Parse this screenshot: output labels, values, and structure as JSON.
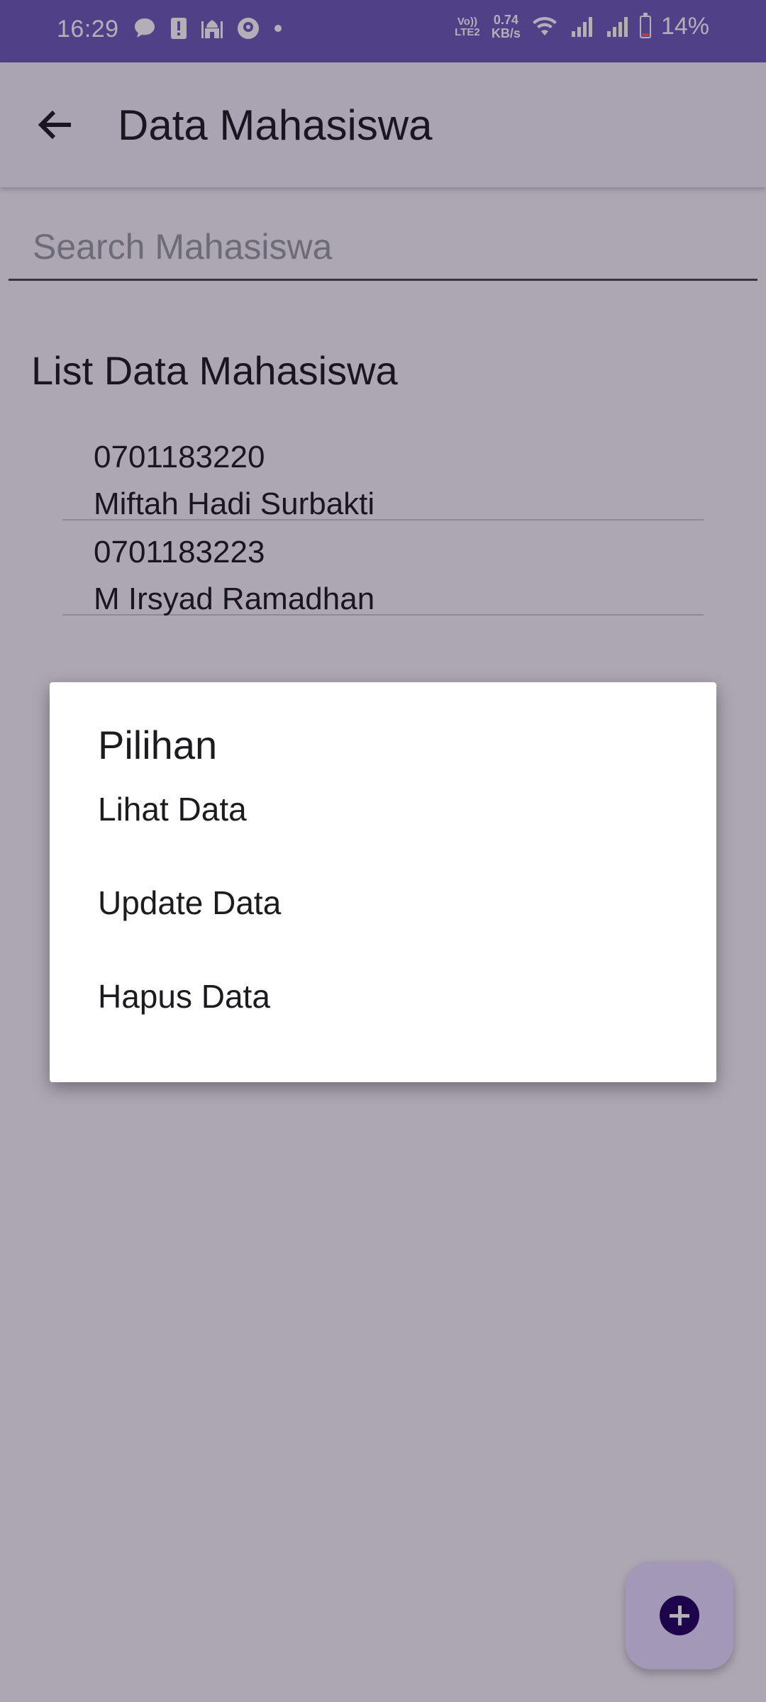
{
  "status_bar": {
    "time": "16:29",
    "network_type": "Vo)) LTE2",
    "net_speed_value": "0.74",
    "net_speed_unit": "KB/s",
    "battery_percent": "14%",
    "left_icons": [
      "message-icon",
      "alert-icon",
      "mosque-app-icon",
      "location-app-icon",
      "dot-icon"
    ],
    "right_icons": [
      "wifi-icon",
      "signal-icon",
      "signal-icon",
      "battery-icon"
    ]
  },
  "app_bar": {
    "title": "Data Mahasiswa",
    "back_icon": "arrow-back-icon"
  },
  "search": {
    "placeholder": "Search Mahasiswa",
    "value": ""
  },
  "list": {
    "heading": "List Data Mahasiswa",
    "items": [
      {
        "nim": "0701183220",
        "name": "Miftah Hadi Surbakti"
      },
      {
        "nim": "0701183223",
        "name": "M Irsyad Ramadhan"
      }
    ]
  },
  "dialog": {
    "title": "Pilihan",
    "options": [
      "Lihat Data",
      "Update Data",
      "Hapus Data"
    ]
  },
  "fab": {
    "icon": "add-icon"
  },
  "colors": {
    "status_bar": "#6c5ab8",
    "app_bar": "#f3eff7",
    "fab_background": "#eaddff",
    "fab_icon": "#21005d",
    "dialog_background": "#ffffff"
  }
}
